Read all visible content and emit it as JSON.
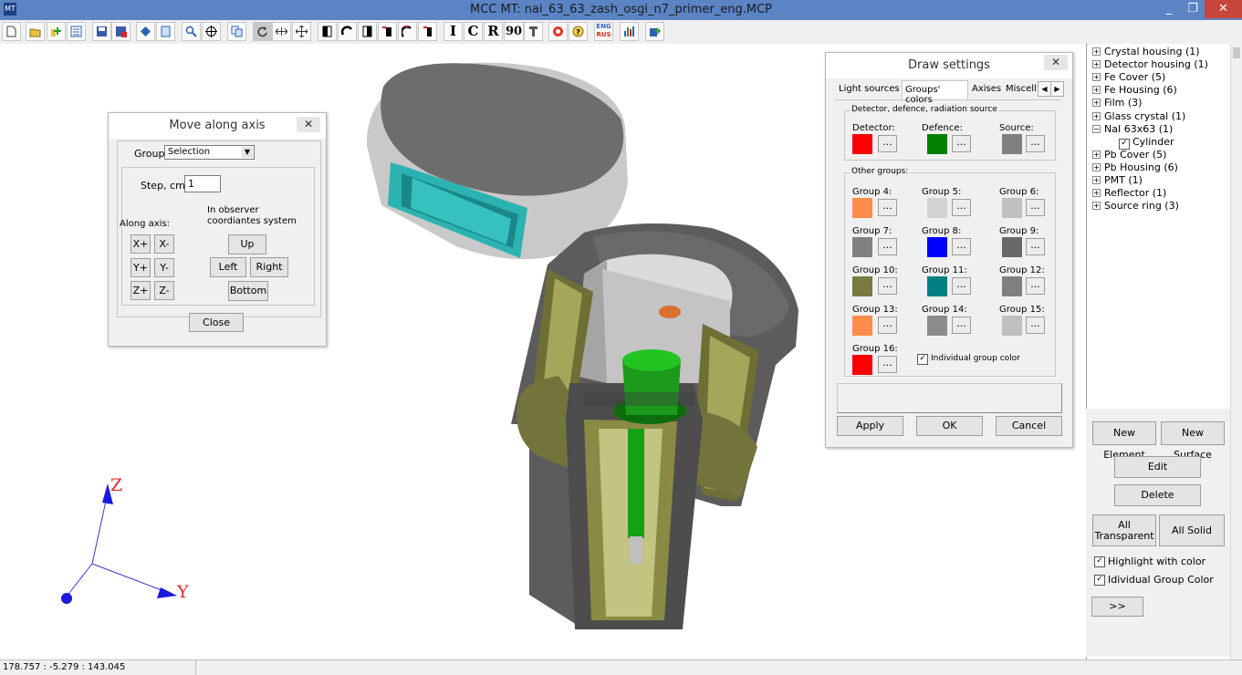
{
  "window": {
    "title": "MCC MT: nai_63_63_zash_osgi_n7_primer_eng.MCP",
    "app_icon": "MT",
    "controls": {
      "minimize": "_",
      "restore": "❐",
      "close": "✕"
    }
  },
  "toolbar": {
    "icons": [
      "new-file-icon",
      "open-folder-icon",
      "add-file-icon",
      "list-icon",
      "save-icon",
      "save-as-icon",
      "diamond-icon",
      "document-icon",
      "search-icon",
      "crosshair-icon",
      "copy-icon",
      "rotate-icon",
      "move-horizontal-icon",
      "move-cross-icon",
      "half-box-icon",
      "arc-icon",
      "half-box-right-icon",
      "clip-icon",
      "rotate-tool-icon",
      "clip-bar-icon",
      "cursor-icon",
      "lifebuoy-icon",
      "help-icon",
      "eng-rus-icon",
      "bar-chart-icon",
      "export-icon"
    ],
    "letter_buttons": [
      "I",
      "C",
      "R",
      "90"
    ],
    "lang_label_top": "ENG",
    "lang_label_bottom": "RUS"
  },
  "move_dialog": {
    "title": "Move along axis",
    "close": "✕",
    "group_label": "Group:",
    "group_value": "Selection",
    "step_label": "Step, cm:",
    "step_value": "1",
    "along_axis_label": "Along axis:",
    "observer_label": "In observer coordiantes system",
    "axis_buttons": [
      "X+",
      "X-",
      "Y+",
      "Y-",
      "Z+",
      "Z-"
    ],
    "up": "Up",
    "left": "Left",
    "right": "Right",
    "bottom": "Bottom",
    "close_button": "Close"
  },
  "draw_settings": {
    "title": "Draw settings",
    "close": "✕",
    "tabs": [
      "Light sources",
      "Groups' colors",
      "Axises",
      "Miscella"
    ],
    "tab_arrows": [
      "◀",
      "▶"
    ],
    "section1": "Detector, defence, radiation source",
    "detector_label": "Detector:",
    "defence_label": "Defence:",
    "source_label": "Source:",
    "detector_color": "#ff0000",
    "defence_color": "#008000",
    "source_color": "#808080",
    "section2": "Other groups:",
    "groups": [
      {
        "label": "Group 4:",
        "color": "#ff8c4b"
      },
      {
        "label": "Group 5:",
        "color": "#d3d3d3"
      },
      {
        "label": "Group 6:",
        "color": "#c0c0c0"
      },
      {
        "label": "Group 7:",
        "color": "#808080"
      },
      {
        "label": "Group 8:",
        "color": "#0000ff"
      },
      {
        "label": "Group 9:",
        "color": "#696969"
      },
      {
        "label": "Group 10:",
        "color": "#7a7a41"
      },
      {
        "label": "Group 11:",
        "color": "#008080"
      },
      {
        "label": "Group 12:",
        "color": "#808080"
      },
      {
        "label": "Group 13:",
        "color": "#ff8c4b"
      },
      {
        "label": "Group 14:",
        "color": "#8c8c8c"
      },
      {
        "label": "Group 15:",
        "color": "#c0c0c0"
      },
      {
        "label": "Group 16:",
        "color": "#ff0000"
      }
    ],
    "dots": "...",
    "individual_label": "Individual group color",
    "individual_checked": "✓",
    "apply": "Apply",
    "ok": "OK",
    "cancel": "Cancel"
  },
  "tree": {
    "items": [
      "Crystal housing (1)",
      "Detector housing  (1)",
      "Fe Cover (5)",
      "Fe Housing (6)",
      "Film (3)",
      "Glass crystal (1)",
      "NaI 63x63 (1)",
      "Cylinder",
      "Pb Cover (5)",
      "Pb Housing (6)",
      "PMT (1)",
      "Reflector (1)",
      "Source ring (3)"
    ],
    "expand": "+",
    "collapse": "−",
    "check": "✓"
  },
  "right_panel": {
    "new_element": "New Element",
    "new_surface": "New Surface",
    "edit": "Edit",
    "delete": "Delete",
    "all_transparent_1": "All",
    "all_transparent_2": "Transparent",
    "all_solid": "All Solid",
    "highlight": "Highlight with color",
    "individual": "Idividual Group Color",
    "check": "✓",
    "more": ">>"
  },
  "axes": {
    "z": "Z",
    "y": "Y"
  },
  "status": {
    "coords": "178.757 : -5.279 : 143.045"
  }
}
